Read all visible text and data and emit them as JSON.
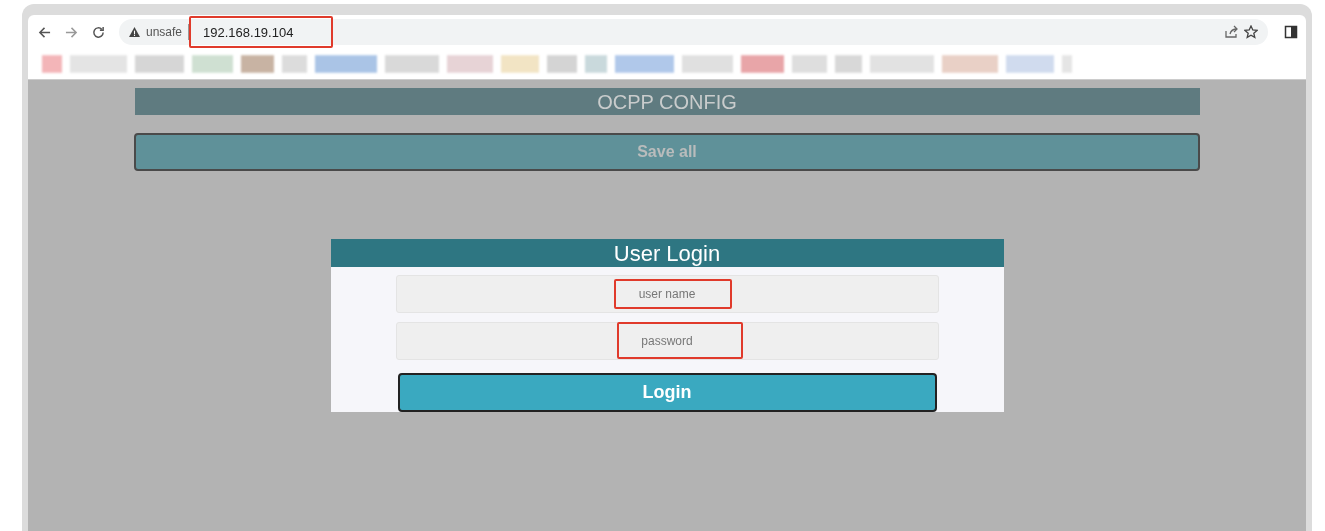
{
  "browser": {
    "security_label": "unsafe",
    "url": "192.168.19.104",
    "url_highlighted": true
  },
  "page": {
    "header": "OCPP CONFIG",
    "save_button": "Save all",
    "login": {
      "title": "User Login",
      "fields": [
        {
          "placeholder": "user name",
          "highlighted": true
        },
        {
          "placeholder": "password",
          "highlighted": true
        }
      ],
      "button": "Login"
    }
  }
}
